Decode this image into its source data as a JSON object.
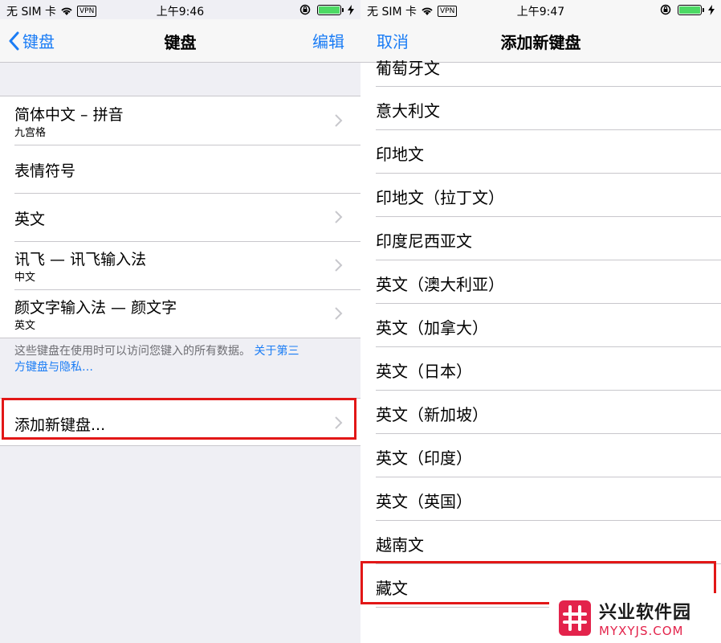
{
  "left": {
    "status": {
      "carrier": "无 SIM 卡",
      "vpn": "VPN",
      "time": "上午9:46"
    },
    "nav": {
      "back": "键盘",
      "title": "键盘",
      "edit": "编辑"
    },
    "keyboards": [
      {
        "title": "简体中文 – 拼音",
        "subtitle": "九宫格"
      },
      {
        "title": "表情符号",
        "subtitle": ""
      },
      {
        "title": "英文",
        "subtitle": ""
      },
      {
        "title": "讯飞 — 讯飞输入法",
        "subtitle": "中文"
      },
      {
        "title": "颜文字输入法 — 颜文字",
        "subtitle": "英文"
      }
    ],
    "footer": {
      "text": "这些键盘在使用时可以访问您键入的所有数据。",
      "link1": "关于第三",
      "link2": "方键盘与隐私…"
    },
    "add_keyboard": "添加新键盘..."
  },
  "right": {
    "status": {
      "carrier": "无 SIM 卡",
      "vpn": "VPN",
      "time": "上午9:47"
    },
    "nav": {
      "cancel": "取消",
      "title": "添加新键盘"
    },
    "languages": [
      "葡萄牙文",
      "意大利文",
      "印地文",
      "印地文（拉丁文）",
      "印度尼西亚文",
      "英文（澳大利亚）",
      "英文（加拿大）",
      "英文（日本）",
      "英文（新加坡）",
      "英文（印度）",
      "英文（英国）",
      "越南文",
      "藏文"
    ]
  },
  "watermark": {
    "name": "兴业软件园",
    "url": "MYXYJS.COM"
  },
  "colors": {
    "accent": "#1a7cf5",
    "highlight": "#e21717",
    "battery": "#4cd964",
    "brand": "#e3234b"
  }
}
